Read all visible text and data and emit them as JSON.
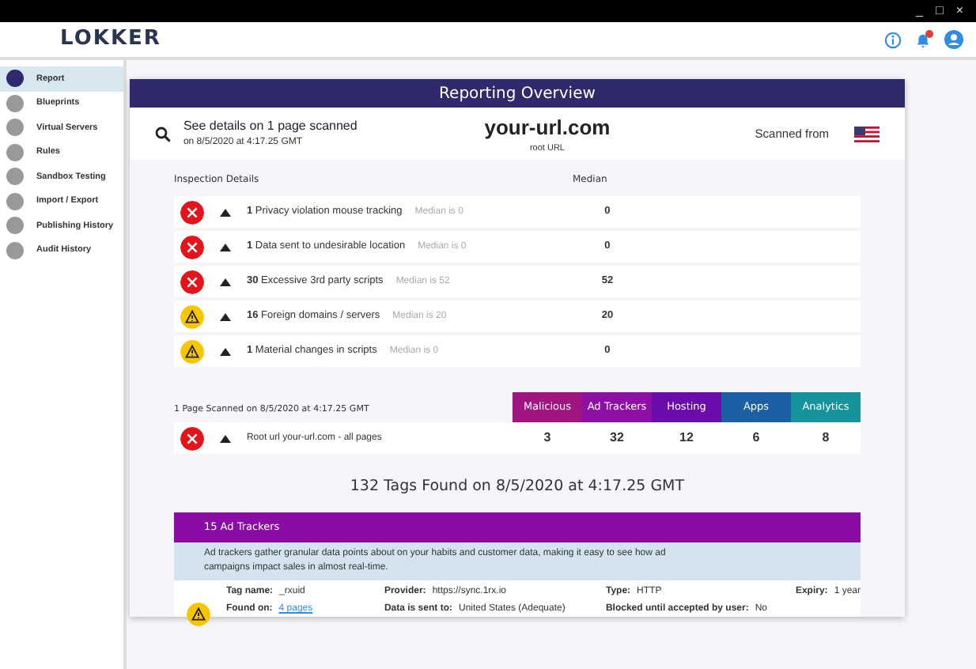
{
  "window_controls": [
    "_",
    "□",
    "×"
  ],
  "header": {
    "logo": "LOKKER",
    "notification_badge": true
  },
  "sidebar": {
    "items": [
      {
        "label": "Report",
        "selected": true
      },
      {
        "label": "Blueprints",
        "selected": false
      },
      {
        "label": "Virtual Servers",
        "selected": false
      },
      {
        "label": "Rules",
        "selected": false
      },
      {
        "label": "Sandbox Testing",
        "selected": false
      },
      {
        "label": "Import / Export",
        "selected": false
      },
      {
        "label": "Publishing History",
        "selected": false
      },
      {
        "label": "Audit History",
        "selected": false
      }
    ]
  },
  "overview": {
    "title": "Reporting Overview",
    "details_title": "See details on 1 page scanned",
    "details_date": "on 8/5/2020 at 4:17.25 GMT",
    "url": "your-url.com",
    "url_caption": "root URL",
    "scanned_from": "Scanned from"
  },
  "inspection": {
    "heading": "Inspection Details",
    "median_heading": "Median",
    "rows": [
      {
        "kind": "error",
        "text": "**1** Privacy violation mouse tracking",
        "median_note": "Median is 0",
        "median": "0"
      },
      {
        "kind": "error",
        "text": "**1** Data sent to undesirable location",
        "median_note": "Median is 0",
        "median": "0"
      },
      {
        "kind": "error",
        "text": "**30** Excessive 3rd party scripts",
        "median_note": "Median is 52",
        "median": "52"
      },
      {
        "kind": "warning",
        "text": "**16** Foreign domains / servers",
        "median_note": "Median is 20",
        "median": "20"
      },
      {
        "kind": "warning",
        "text": "**1** Material changes in scripts",
        "median_note": "Median is 0",
        "median": "0"
      }
    ]
  },
  "pages": {
    "heading": "1 Page Scanned on 8/5/2020 at 4:17.25 GMT",
    "categories": [
      {
        "label": "Malicious",
        "color": "#a0157f"
      },
      {
        "label": "Ad Trackers",
        "color": "#8e0fa6"
      },
      {
        "label": "Hosting",
        "color": "#6a0bab"
      },
      {
        "label": "Apps",
        "color": "#1b5fa5"
      },
      {
        "label": "Analytics",
        "color": "#17939c"
      }
    ],
    "rows": [
      {
        "kind": "error",
        "label": "Root url your-url.com - all pages",
        "values": [
          "3",
          "32",
          "12",
          "6",
          "8"
        ]
      }
    ]
  },
  "tags_title": "132 Tags Found on 8/5/2020 at 4:17.25 GMT",
  "ad_trackers": {
    "title": "15 Ad Trackers",
    "description": "Ad trackers gather granular data points about on your habits and customer data, making it easy to see how ad campaigns impact sales in almost real-time.",
    "tags": [
      {
        "kind": "warning",
        "fields": [
          {
            "label": "Tag name:",
            "value": "_rxuid",
            "kind": "text"
          },
          {
            "label": "Provider:",
            "value": "https://sync.1rx.io",
            "kind": "text"
          },
          {
            "label": "Type:",
            "value": "HTTP",
            "kind": "text"
          },
          {
            "label": "Expiry:",
            "value": "1 year",
            "kind": "text"
          },
          {
            "label": "Found on:",
            "value": "4 pages",
            "kind": "link"
          },
          {
            "label": "Data is sent to:",
            "value": "United States (Adequate)",
            "kind": "text"
          },
          {
            "label": "Blocked until accepted by user:",
            "value": "No",
            "kind": "text"
          }
        ]
      }
    ]
  }
}
